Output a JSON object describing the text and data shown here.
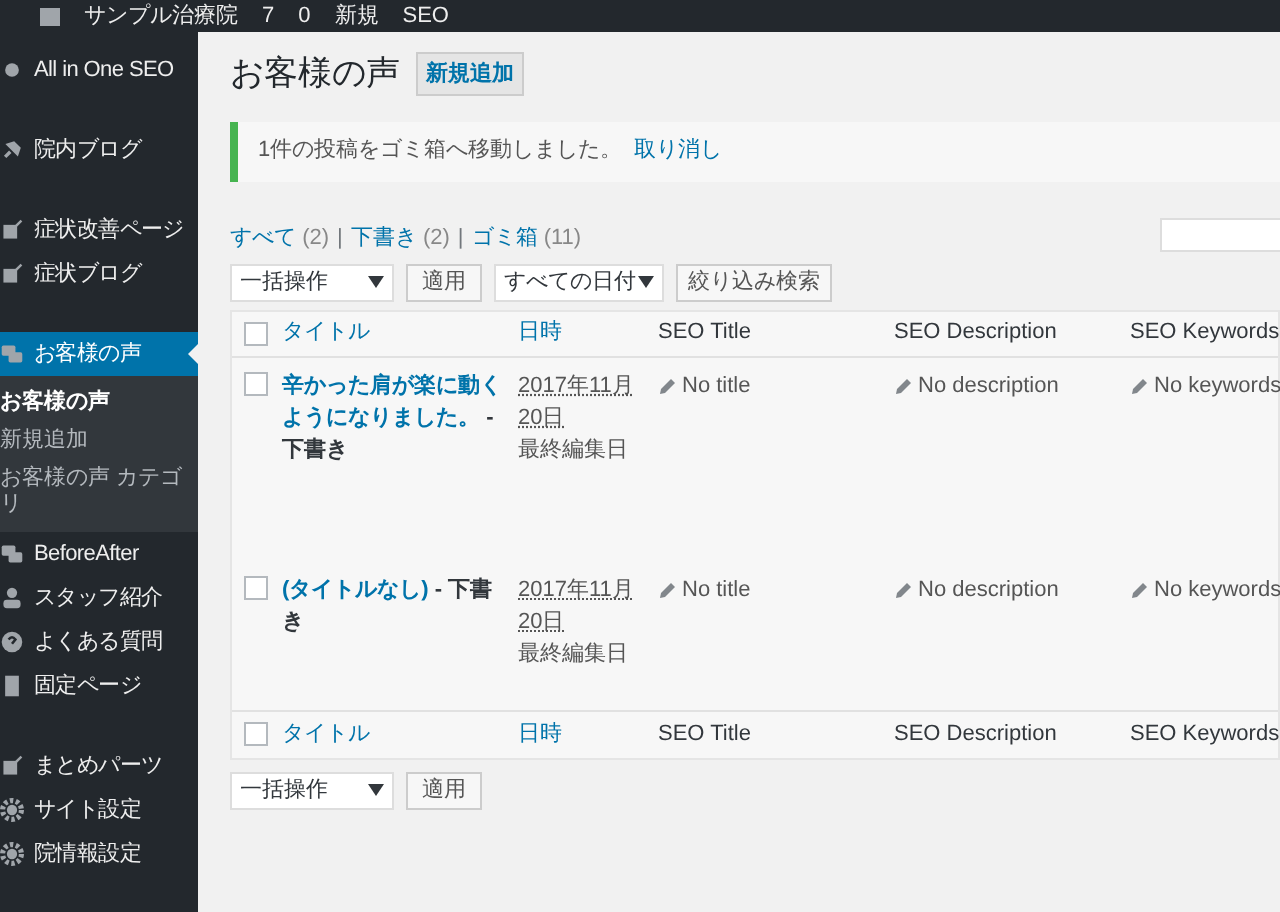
{
  "admin_bar": {
    "site_name": "サンプル治療院",
    "updates": "7",
    "comments": "0",
    "new": "新規",
    "seo": "SEO"
  },
  "sidebar": {
    "groups": [
      {
        "items": [
          {
            "label": "All in One SEO",
            "kind": "dot",
            "selected": false
          }
        ]
      },
      {
        "items": [
          {
            "label": "院内ブログ",
            "kind": "pin",
            "selected": false
          }
        ]
      },
      {
        "items": [
          {
            "label": "症状改善ページ",
            "kind": "edit",
            "selected": false
          },
          {
            "label": "症状ブログ",
            "kind": "edit",
            "selected": false
          }
        ]
      },
      {
        "items": [
          {
            "label": "お客様の声",
            "kind": "chat",
            "selected": true,
            "submenu": [
              {
                "label": "お客様の声",
                "selected": true
              },
              {
                "label": "新規追加",
                "selected": false
              },
              {
                "label": "お客様の声 カテゴリ",
                "selected": false
              }
            ]
          },
          {
            "label": "BeforeAfter",
            "kind": "chat",
            "selected": false
          },
          {
            "label": "スタッフ紹介",
            "kind": "user",
            "selected": false
          },
          {
            "label": "よくある質問",
            "kind": "help",
            "selected": false
          },
          {
            "label": "固定ページ",
            "kind": "page",
            "selected": false
          }
        ]
      },
      {
        "items": [
          {
            "label": "まとめパーツ",
            "kind": "edit",
            "selected": false
          },
          {
            "label": "サイト設定",
            "kind": "gear",
            "selected": false
          },
          {
            "label": "院情報設定",
            "kind": "gear",
            "selected": false
          }
        ]
      }
    ]
  },
  "page": {
    "title": "お客様の声",
    "add_new": "新規追加"
  },
  "notice": {
    "message": "1件の投稿をゴミ箱へ移動しました。",
    "undo": "取り消し"
  },
  "views": [
    {
      "label": "すべて",
      "count": "(2)"
    },
    {
      "separator": "|",
      "label": "下書き",
      "count": "(2)"
    },
    {
      "separator": "|",
      "label": "ゴミ箱",
      "count": "(11)"
    }
  ],
  "filters": {
    "bulk_action": "一括操作",
    "apply": "適用",
    "dates": "すべての日付",
    "filter": "絞り込み検索"
  },
  "table": {
    "header": {
      "select_all_checked": false,
      "columns": [
        "タイトル",
        "日時",
        "SEO Title",
        "SEO Description",
        "SEO Keywords"
      ]
    },
    "footer": {
      "select_all_checked": false,
      "columns": [
        "タイトル",
        "日時",
        "SEO Title",
        "SEO Description",
        "SEO Keywords"
      ]
    },
    "rows": [
      {
        "checked": false,
        "title": "辛かった肩が楽に動くようになりました。",
        "status": "- 下書き",
        "date": "2017年11月20日",
        "date_label": "最終編集日",
        "seo_title": "No title",
        "seo_description": "No description",
        "seo_keywords": "No keywords"
      },
      {
        "checked": false,
        "title": "(タイトルなし)",
        "status": "- 下書き",
        "date": "2017年11月20日",
        "date_label": "最終編集日",
        "seo_title": "No title",
        "seo_description": "No description",
        "seo_keywords": "No keywords"
      }
    ]
  },
  "bottom_filters": {
    "bulk_action": "一括操作",
    "apply": "適用"
  }
}
